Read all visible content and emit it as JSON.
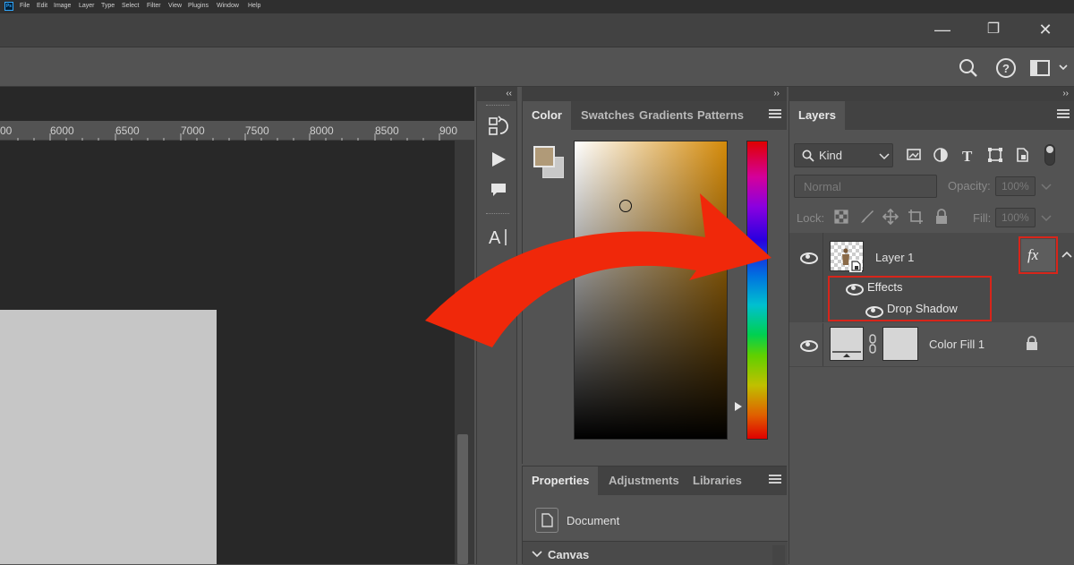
{
  "menu": [
    "File",
    "Edit",
    "Image",
    "Layer",
    "Type",
    "Select",
    "Filter",
    "View",
    "Plugins",
    "Window",
    "Help"
  ],
  "app_logo": "Ps",
  "window_controls": {
    "minimize": "—",
    "restore": "❐",
    "close": "✕"
  },
  "ruler": {
    "ticks": [
      "00",
      "6000",
      "6500",
      "7000",
      "7500",
      "8000",
      "8500",
      "900"
    ]
  },
  "collapse_glyphs": {
    "left": "‹‹",
    "right": "››"
  },
  "color_panel": {
    "tabs": [
      "Color",
      "Swatches",
      "Gradients",
      "Patterns"
    ],
    "active_tab": "Color",
    "foreground_color": "#b09a78",
    "background_color": "#c8c8c8",
    "field_hue": "#d48a09"
  },
  "properties_panel": {
    "tabs": [
      "Properties",
      "Adjustments",
      "Libraries"
    ],
    "doc_label": "Document",
    "section": "Canvas"
  },
  "layers_panel": {
    "tab": "Layers",
    "filter_kind": "Kind",
    "blend_mode": "Normal",
    "opacity_label": "Opacity:",
    "opacity_value": "100%",
    "lock_label": "Lock:",
    "fill_label": "Fill:",
    "fill_value": "100%",
    "fx_label": "fx",
    "layers": [
      {
        "name": "Layer 1",
        "effects_label": "Effects",
        "effect": "Drop Shadow"
      },
      {
        "name": "Color Fill 1"
      }
    ]
  },
  "highlight_color": "#d8251a",
  "arrow_color": "#f0280a"
}
